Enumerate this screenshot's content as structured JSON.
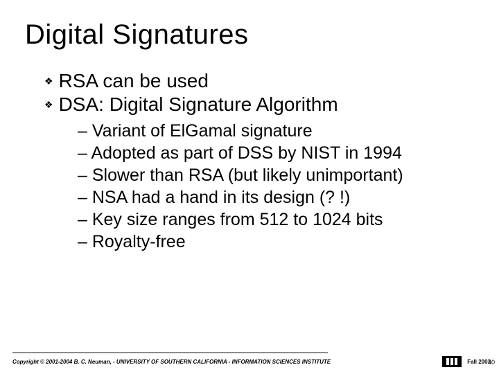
{
  "title": "Digital Signatures",
  "bullets": {
    "item0": "RSA can be used",
    "item1": "DSA: Digital Signature Algorithm"
  },
  "sub": {
    "s0": "– Variant of ElGamal signature",
    "s1": "– Adopted as part of DSS by NIST in 1994",
    "s2": "– Slower than RSA (but likely unimportant)",
    "s3": "– NSA had a hand in its design (? !)",
    "s4": "– Key size ranges from 512 to 1024 bits",
    "s5": "– Royalty-free"
  },
  "footer": {
    "copyright": "Copyright © 2001-2004  B. C. Neuman, - UNIVERSITY OF SOUTHERN CALIFORNIA - INFORMATION SCIENCES INSTITUTE",
    "term": "Fall 2003",
    "page": "40"
  }
}
